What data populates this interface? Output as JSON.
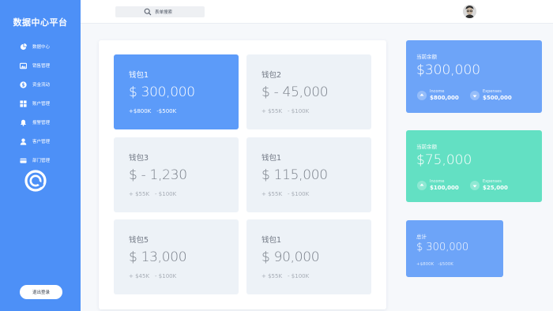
{
  "sidebar": {
    "brand": "数据中心平台",
    "items": [
      {
        "label": "数据中心",
        "icon": "pie-chart-icon"
      },
      {
        "label": "销售管理",
        "icon": "image-icon"
      },
      {
        "label": "资金流动",
        "icon": "dollar-icon"
      },
      {
        "label": "账户管理",
        "icon": "grid-icon"
      },
      {
        "label": "报警管理",
        "icon": "bell-icon"
      },
      {
        "label": "客户管理",
        "icon": "user-icon"
      },
      {
        "label": "部门管理",
        "icon": "card-icon"
      }
    ],
    "logout": "退出登录"
  },
  "topbar": {
    "search_label": "表单搜索"
  },
  "wallets": [
    {
      "name": "钱包1",
      "amount": "$ 300,000",
      "income": "+$800K",
      "expense": "-$500K",
      "active": true
    },
    {
      "name": "钱包2",
      "amount": "$ - 45,000",
      "income": "+ $55K",
      "expense": "- $100K"
    },
    {
      "name": "钱包3",
      "amount": "$ - 1,230",
      "income": "+ $55K",
      "expense": "- $100K"
    },
    {
      "name": "钱包1",
      "amount": "$ 115,000",
      "income": "+ $55K",
      "expense": "- $100K"
    },
    {
      "name": "钱包5",
      "amount": "$ 13,000",
      "income": "+ $45K",
      "expense": "- $100K"
    },
    {
      "name": "钱包1",
      "amount": "$ 90,000",
      "income": "+ $55K",
      "expense": "- $100K"
    }
  ],
  "summary_cards": [
    {
      "title": "当前余额",
      "value": "$300,000",
      "income_label": "Income",
      "income": "$800,000",
      "expense_label": "Expenses",
      "expense": "$500,000",
      "color": "#6da4f8"
    },
    {
      "title": "当前余额",
      "value": "$75,000",
      "income_label": "Income",
      "income": "$100,000",
      "expense_label": "Expenses",
      "expense": "$25,000",
      "color": "#63e0c3"
    }
  ],
  "total_card": {
    "title": "总计",
    "value": "$ 300,000",
    "income": "+$800K",
    "expense": "-$500K",
    "color": "#6da4f8"
  },
  "colors": {
    "sidebar": "#4d90f7",
    "accent": "#5c9bf9",
    "teal": "#63e0c3"
  }
}
